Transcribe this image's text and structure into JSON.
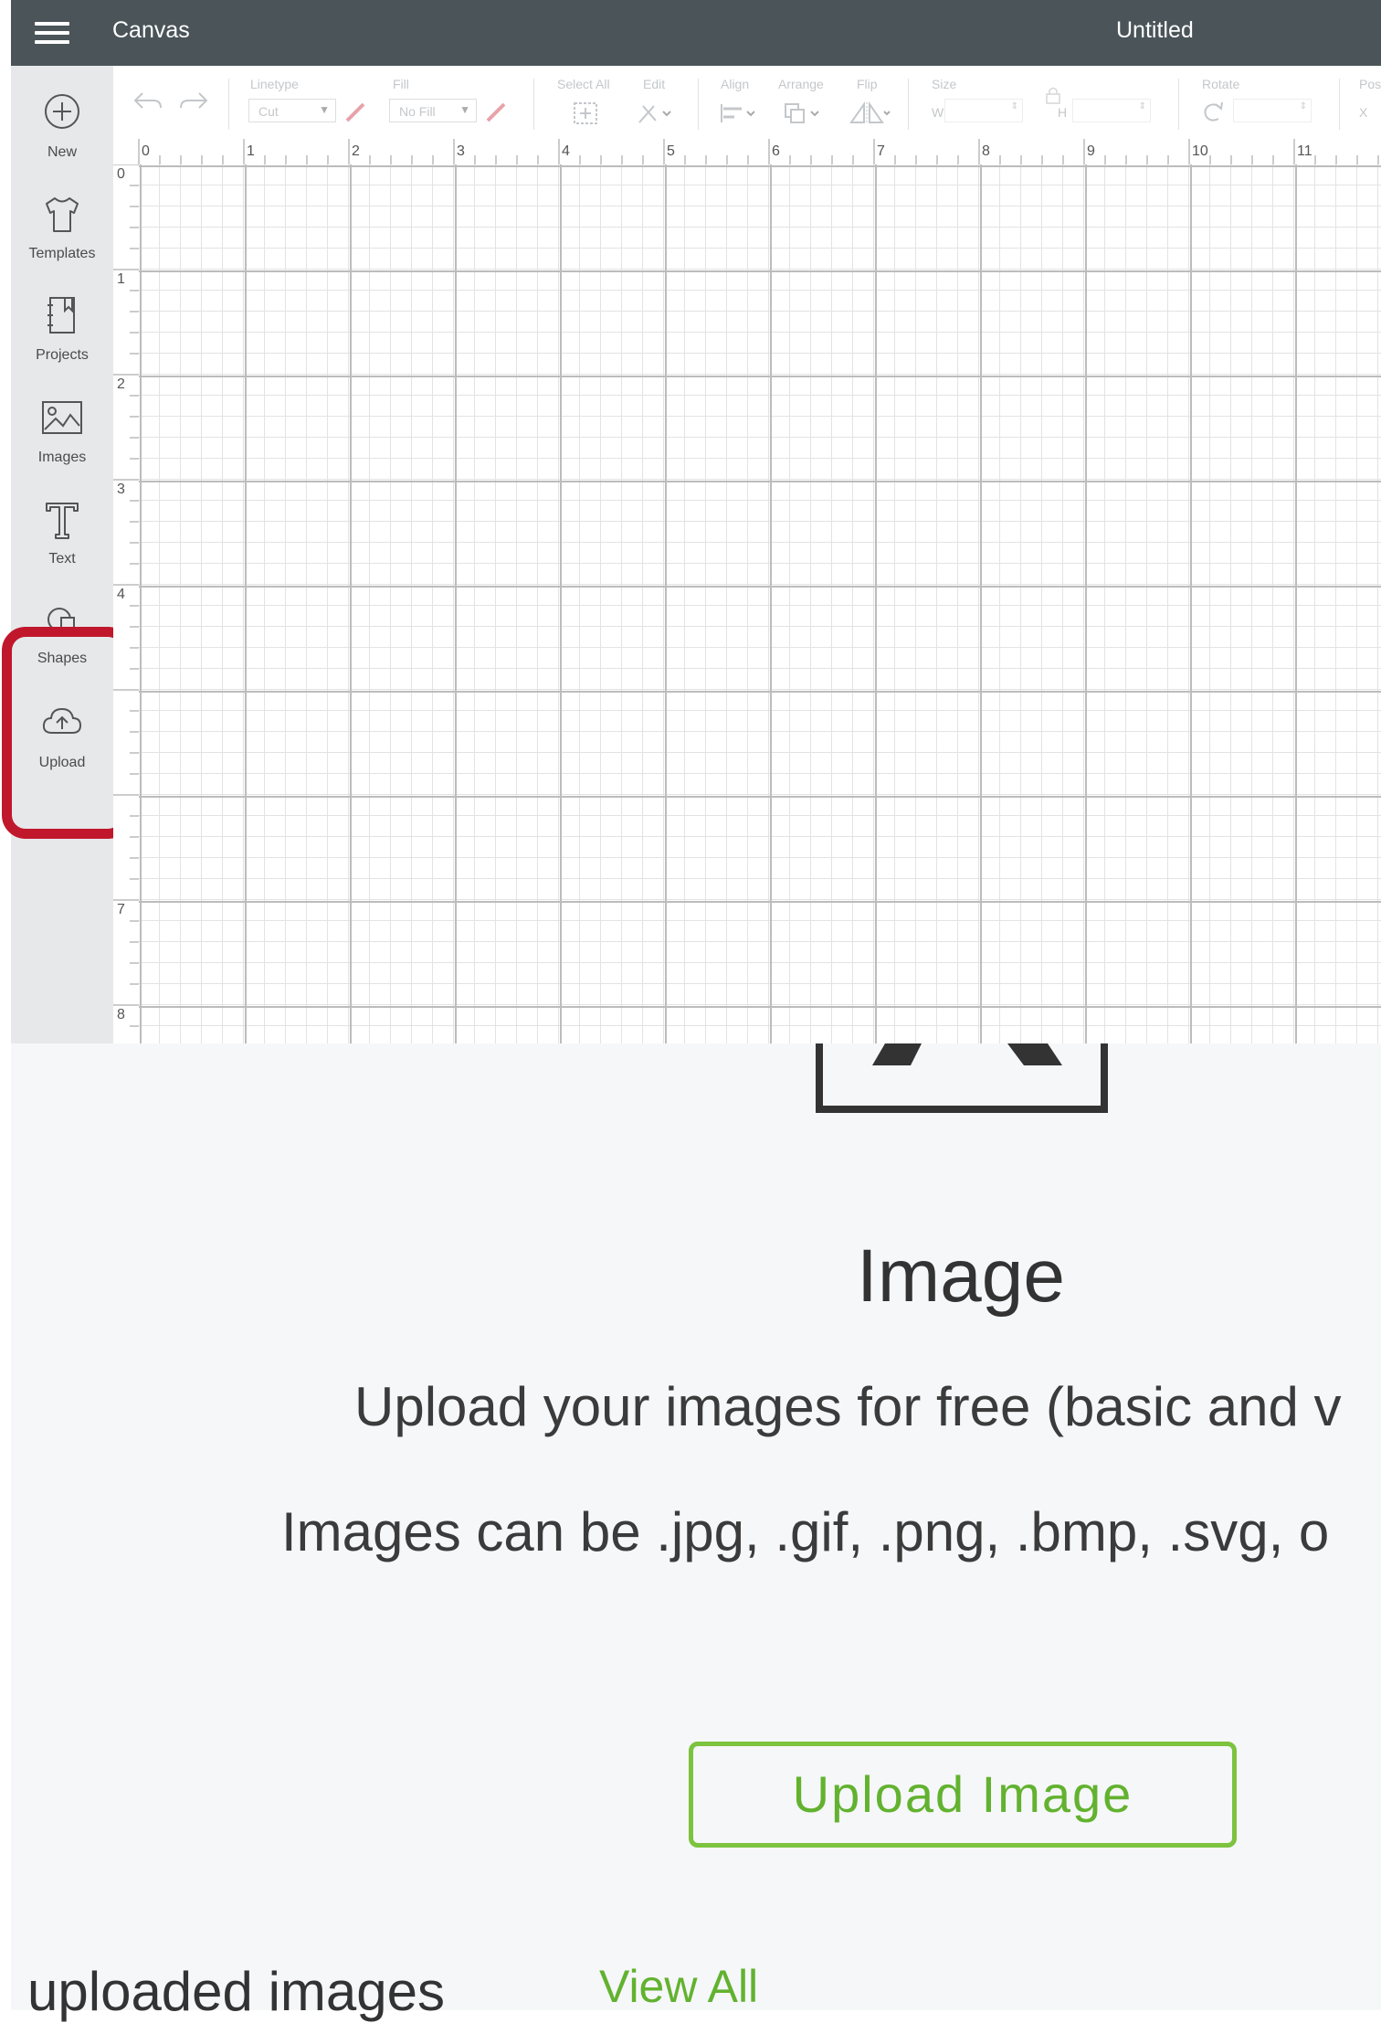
{
  "header": {
    "app_title": "Canvas",
    "document_title": "Untitled"
  },
  "sidebar": {
    "items": [
      {
        "label": "New",
        "icon": "plus-circle-icon"
      },
      {
        "label": "Templates",
        "icon": "tshirt-icon"
      },
      {
        "label": "Projects",
        "icon": "book-icon"
      },
      {
        "label": "Images",
        "icon": "image-icon"
      },
      {
        "label": "Text",
        "icon": "text-t-icon"
      },
      {
        "label": "Shapes",
        "icon": "shapes-icon"
      },
      {
        "label": "Upload",
        "icon": "cloud-upload-icon"
      }
    ],
    "highlighted_item": "Upload",
    "highlight_color": "#c1172c"
  },
  "toolbar": {
    "linetype_label": "Linetype",
    "linetype_value": "Cut",
    "fill_label": "Fill",
    "fill_value": "No Fill",
    "select_all_label": "Select All",
    "edit_label": "Edit",
    "align_label": "Align",
    "arrange_label": "Arrange",
    "flip_label": "Flip",
    "size_label": "Size",
    "width_label": "W",
    "height_label": "H",
    "rotate_label": "Rotate",
    "position_label": "Pos",
    "x_label": "X"
  },
  "rulers": {
    "horizontal": [
      "0",
      "1",
      "2",
      "3",
      "4",
      "5",
      "6",
      "7",
      "8",
      "9",
      "10",
      "11"
    ],
    "vertical": [
      "0",
      "1",
      "2",
      "3",
      "4",
      "7",
      "8"
    ]
  },
  "upload_panel": {
    "heading": "Image",
    "description": "Upload your images for free (basic and v",
    "formats": "Images can be .jpg, .gif, .png, .bmp, .svg, o",
    "upload_button": "Upload Image",
    "recent_heading": "uploaded images",
    "view_all": "View All"
  },
  "colors": {
    "topbar": "#4a5459",
    "accent_green": "#62b22f",
    "highlight_red": "#c1172c"
  }
}
